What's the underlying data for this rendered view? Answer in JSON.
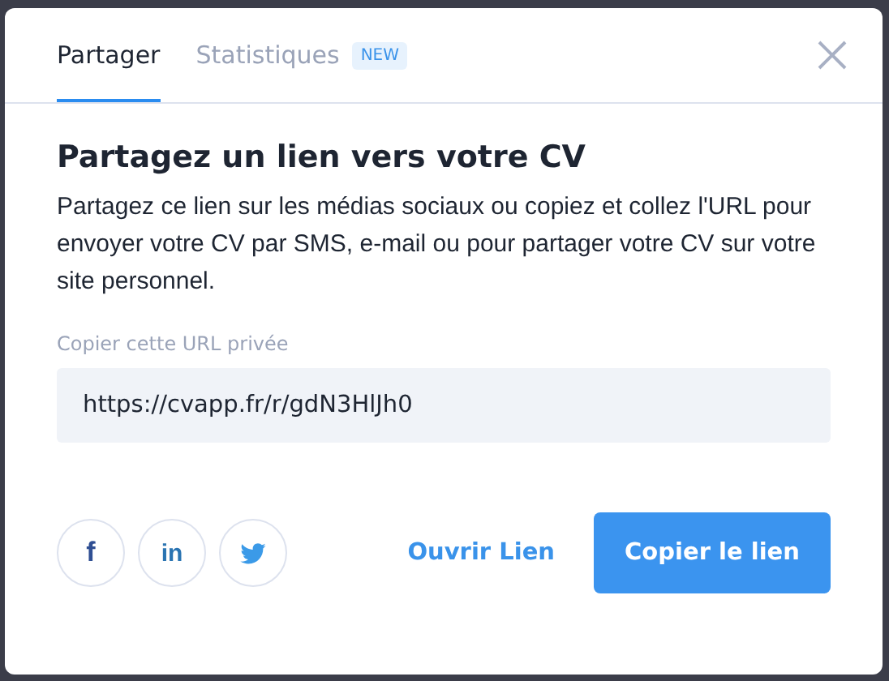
{
  "tabs": [
    {
      "label": "Partager",
      "selected": true
    },
    {
      "label": "Statistiques",
      "selected": false,
      "badge": "NEW"
    }
  ],
  "heading": "Partagez un lien vers votre CV",
  "description": "Partagez ce lien sur les médias sociaux ou copiez et collez l'URL pour envoyer votre CV par SMS, e-mail ou pour partager votre CV sur votre site personnel.",
  "url_field": {
    "label": "Copier cette URL privée",
    "value": "https://cvapp.fr/r/gdN3HlJh0"
  },
  "social": [
    {
      "kind": "facebook",
      "glyph": "f"
    },
    {
      "kind": "linkedin",
      "glyph": "in"
    },
    {
      "kind": "twitter"
    }
  ],
  "actions": {
    "open_link": "Ouvrir Lien",
    "copy_link": "Copier le lien"
  }
}
